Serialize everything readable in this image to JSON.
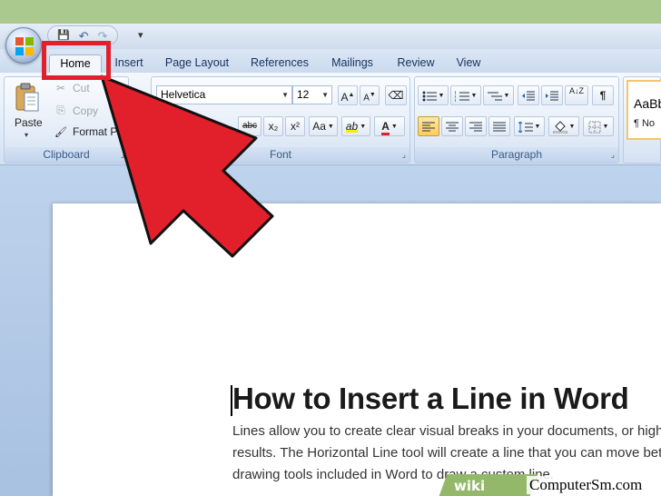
{
  "colors": {
    "accent": "#e2202c",
    "ribbon": "#dbe6f4",
    "selected": "#ffcc5a"
  },
  "quick_access": {
    "icons": [
      "save-icon",
      "undo-icon",
      "redo-icon",
      "customize-icon"
    ],
    "glyph_save": "💾",
    "glyph_undo": "↶",
    "glyph_redo": "↷",
    "glyph_more": "▾"
  },
  "tabs": [
    {
      "label": "Home"
    },
    {
      "label": "Insert"
    },
    {
      "label": "Page Layout"
    },
    {
      "label": "References"
    },
    {
      "label": "Mailings"
    },
    {
      "label": "Review"
    },
    {
      "label": "View"
    }
  ],
  "clipboard": {
    "group_label": "Clipboard",
    "paste_label": "Paste",
    "cut_label": "Cut",
    "copy_label": "Copy",
    "format_painter_label": "Format P",
    "icon_cut": "✂",
    "icon_copy": "⎘",
    "icon_brush": "🖌"
  },
  "font": {
    "group_label": "Font",
    "family": "Helvetica",
    "size": "12",
    "grow": "A",
    "shrink": "A",
    "clear": "⌫",
    "strike": "abc",
    "subscript": "x₂",
    "superscript": "x²",
    "change_case": "Aa",
    "highlight": "ab",
    "color": "A"
  },
  "paragraph": {
    "group_label": "Paragraph",
    "show_marks": "¶",
    "sort": "A↓Z"
  },
  "styles": {
    "sample": "AaBb",
    "name": "¶ No"
  },
  "document": {
    "title": "How to Insert a Line in Word",
    "lines": [
      "Lines allow you to create clear visual breaks in your documents, or high",
      "results. The Horizontal Line tool will create a line that you can move bet",
      "drawing tools included in Word to draw a custom line."
    ]
  },
  "watermark": {
    "wiki": "wiki",
    "site": "ComputerSm.com"
  }
}
